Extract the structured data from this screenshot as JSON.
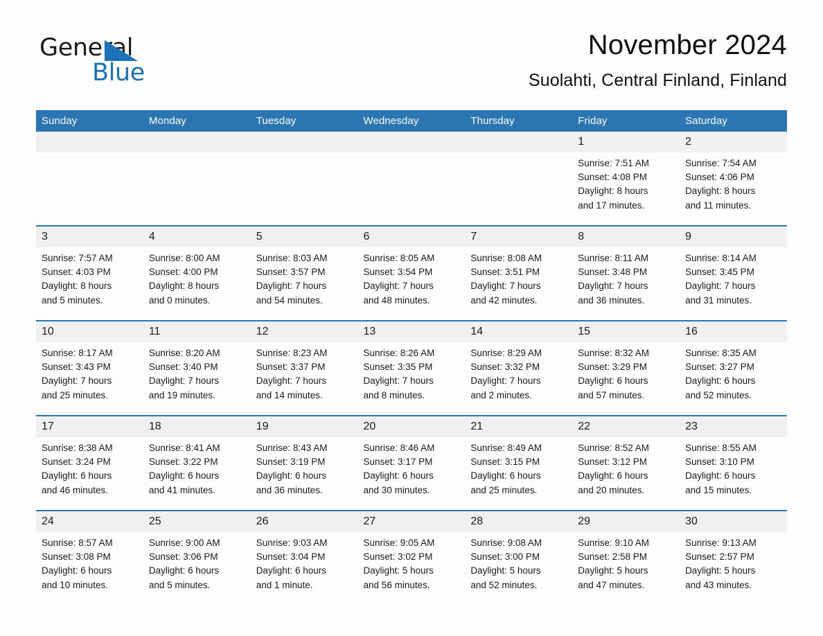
{
  "brand": {
    "name_top": "General",
    "name_bottom": "Blue",
    "triangle_color": "#1a72b8"
  },
  "header": {
    "title": "November 2024",
    "location": "Suolahti, Central Finland, Finland"
  },
  "theme": {
    "header_blue": "#2b75b3",
    "daynum_band": "#f0f0f0",
    "page_background": "#fdfdfd",
    "text": "#1a1a1a"
  },
  "calendar": {
    "weekday_headers": [
      "Sunday",
      "Monday",
      "Tuesday",
      "Wednesday",
      "Thursday",
      "Friday",
      "Saturday"
    ],
    "labels": {
      "sunrise_prefix": "Sunrise:",
      "sunset_prefix": "Sunset:",
      "daylight_prefix": "Daylight:"
    },
    "weeks": [
      [
        {
          "day": "",
          "empty": true
        },
        {
          "day": "",
          "empty": true
        },
        {
          "day": "",
          "empty": true
        },
        {
          "day": "",
          "empty": true
        },
        {
          "day": "",
          "empty": true
        },
        {
          "day": "1",
          "sunrise": "Sunrise: 7:51 AM",
          "sunset": "Sunset: 4:08 PM",
          "daylight_line1": "Daylight: 8 hours",
          "daylight_line2": "and 17 minutes."
        },
        {
          "day": "2",
          "sunrise": "Sunrise: 7:54 AM",
          "sunset": "Sunset: 4:06 PM",
          "daylight_line1": "Daylight: 8 hours",
          "daylight_line2": "and 11 minutes."
        }
      ],
      [
        {
          "day": "3",
          "sunrise": "Sunrise: 7:57 AM",
          "sunset": "Sunset: 4:03 PM",
          "daylight_line1": "Daylight: 8 hours",
          "daylight_line2": "and 5 minutes."
        },
        {
          "day": "4",
          "sunrise": "Sunrise: 8:00 AM",
          "sunset": "Sunset: 4:00 PM",
          "daylight_line1": "Daylight: 8 hours",
          "daylight_line2": "and 0 minutes."
        },
        {
          "day": "5",
          "sunrise": "Sunrise: 8:03 AM",
          "sunset": "Sunset: 3:57 PM",
          "daylight_line1": "Daylight: 7 hours",
          "daylight_line2": "and 54 minutes."
        },
        {
          "day": "6",
          "sunrise": "Sunrise: 8:05 AM",
          "sunset": "Sunset: 3:54 PM",
          "daylight_line1": "Daylight: 7 hours",
          "daylight_line2": "and 48 minutes."
        },
        {
          "day": "7",
          "sunrise": "Sunrise: 8:08 AM",
          "sunset": "Sunset: 3:51 PM",
          "daylight_line1": "Daylight: 7 hours",
          "daylight_line2": "and 42 minutes."
        },
        {
          "day": "8",
          "sunrise": "Sunrise: 8:11 AM",
          "sunset": "Sunset: 3:48 PM",
          "daylight_line1": "Daylight: 7 hours",
          "daylight_line2": "and 36 minutes."
        },
        {
          "day": "9",
          "sunrise": "Sunrise: 8:14 AM",
          "sunset": "Sunset: 3:45 PM",
          "daylight_line1": "Daylight: 7 hours",
          "daylight_line2": "and 31 minutes."
        }
      ],
      [
        {
          "day": "10",
          "sunrise": "Sunrise: 8:17 AM",
          "sunset": "Sunset: 3:43 PM",
          "daylight_line1": "Daylight: 7 hours",
          "daylight_line2": "and 25 minutes."
        },
        {
          "day": "11",
          "sunrise": "Sunrise: 8:20 AM",
          "sunset": "Sunset: 3:40 PM",
          "daylight_line1": "Daylight: 7 hours",
          "daylight_line2": "and 19 minutes."
        },
        {
          "day": "12",
          "sunrise": "Sunrise: 8:23 AM",
          "sunset": "Sunset: 3:37 PM",
          "daylight_line1": "Daylight: 7 hours",
          "daylight_line2": "and 14 minutes."
        },
        {
          "day": "13",
          "sunrise": "Sunrise: 8:26 AM",
          "sunset": "Sunset: 3:35 PM",
          "daylight_line1": "Daylight: 7 hours",
          "daylight_line2": "and 8 minutes."
        },
        {
          "day": "14",
          "sunrise": "Sunrise: 8:29 AM",
          "sunset": "Sunset: 3:32 PM",
          "daylight_line1": "Daylight: 7 hours",
          "daylight_line2": "and 2 minutes."
        },
        {
          "day": "15",
          "sunrise": "Sunrise: 8:32 AM",
          "sunset": "Sunset: 3:29 PM",
          "daylight_line1": "Daylight: 6 hours",
          "daylight_line2": "and 57 minutes."
        },
        {
          "day": "16",
          "sunrise": "Sunrise: 8:35 AM",
          "sunset": "Sunset: 3:27 PM",
          "daylight_line1": "Daylight: 6 hours",
          "daylight_line2": "and 52 minutes."
        }
      ],
      [
        {
          "day": "17",
          "sunrise": "Sunrise: 8:38 AM",
          "sunset": "Sunset: 3:24 PM",
          "daylight_line1": "Daylight: 6 hours",
          "daylight_line2": "and 46 minutes."
        },
        {
          "day": "18",
          "sunrise": "Sunrise: 8:41 AM",
          "sunset": "Sunset: 3:22 PM",
          "daylight_line1": "Daylight: 6 hours",
          "daylight_line2": "and 41 minutes."
        },
        {
          "day": "19",
          "sunrise": "Sunrise: 8:43 AM",
          "sunset": "Sunset: 3:19 PM",
          "daylight_line1": "Daylight: 6 hours",
          "daylight_line2": "and 36 minutes."
        },
        {
          "day": "20",
          "sunrise": "Sunrise: 8:46 AM",
          "sunset": "Sunset: 3:17 PM",
          "daylight_line1": "Daylight: 6 hours",
          "daylight_line2": "and 30 minutes."
        },
        {
          "day": "21",
          "sunrise": "Sunrise: 8:49 AM",
          "sunset": "Sunset: 3:15 PM",
          "daylight_line1": "Daylight: 6 hours",
          "daylight_line2": "and 25 minutes."
        },
        {
          "day": "22",
          "sunrise": "Sunrise: 8:52 AM",
          "sunset": "Sunset: 3:12 PM",
          "daylight_line1": "Daylight: 6 hours",
          "daylight_line2": "and 20 minutes."
        },
        {
          "day": "23",
          "sunrise": "Sunrise: 8:55 AM",
          "sunset": "Sunset: 3:10 PM",
          "daylight_line1": "Daylight: 6 hours",
          "daylight_line2": "and 15 minutes."
        }
      ],
      [
        {
          "day": "24",
          "sunrise": "Sunrise: 8:57 AM",
          "sunset": "Sunset: 3:08 PM",
          "daylight_line1": "Daylight: 6 hours",
          "daylight_line2": "and 10 minutes."
        },
        {
          "day": "25",
          "sunrise": "Sunrise: 9:00 AM",
          "sunset": "Sunset: 3:06 PM",
          "daylight_line1": "Daylight: 6 hours",
          "daylight_line2": "and 5 minutes."
        },
        {
          "day": "26",
          "sunrise": "Sunrise: 9:03 AM",
          "sunset": "Sunset: 3:04 PM",
          "daylight_line1": "Daylight: 6 hours",
          "daylight_line2": "and 1 minute."
        },
        {
          "day": "27",
          "sunrise": "Sunrise: 9:05 AM",
          "sunset": "Sunset: 3:02 PM",
          "daylight_line1": "Daylight: 5 hours",
          "daylight_line2": "and 56 minutes."
        },
        {
          "day": "28",
          "sunrise": "Sunrise: 9:08 AM",
          "sunset": "Sunset: 3:00 PM",
          "daylight_line1": "Daylight: 5 hours",
          "daylight_line2": "and 52 minutes."
        },
        {
          "day": "29",
          "sunrise": "Sunrise: 9:10 AM",
          "sunset": "Sunset: 2:58 PM",
          "daylight_line1": "Daylight: 5 hours",
          "daylight_line2": "and 47 minutes."
        },
        {
          "day": "30",
          "sunrise": "Sunrise: 9:13 AM",
          "sunset": "Sunset: 2:57 PM",
          "daylight_line1": "Daylight: 5 hours",
          "daylight_line2": "and 43 minutes."
        }
      ]
    ]
  }
}
